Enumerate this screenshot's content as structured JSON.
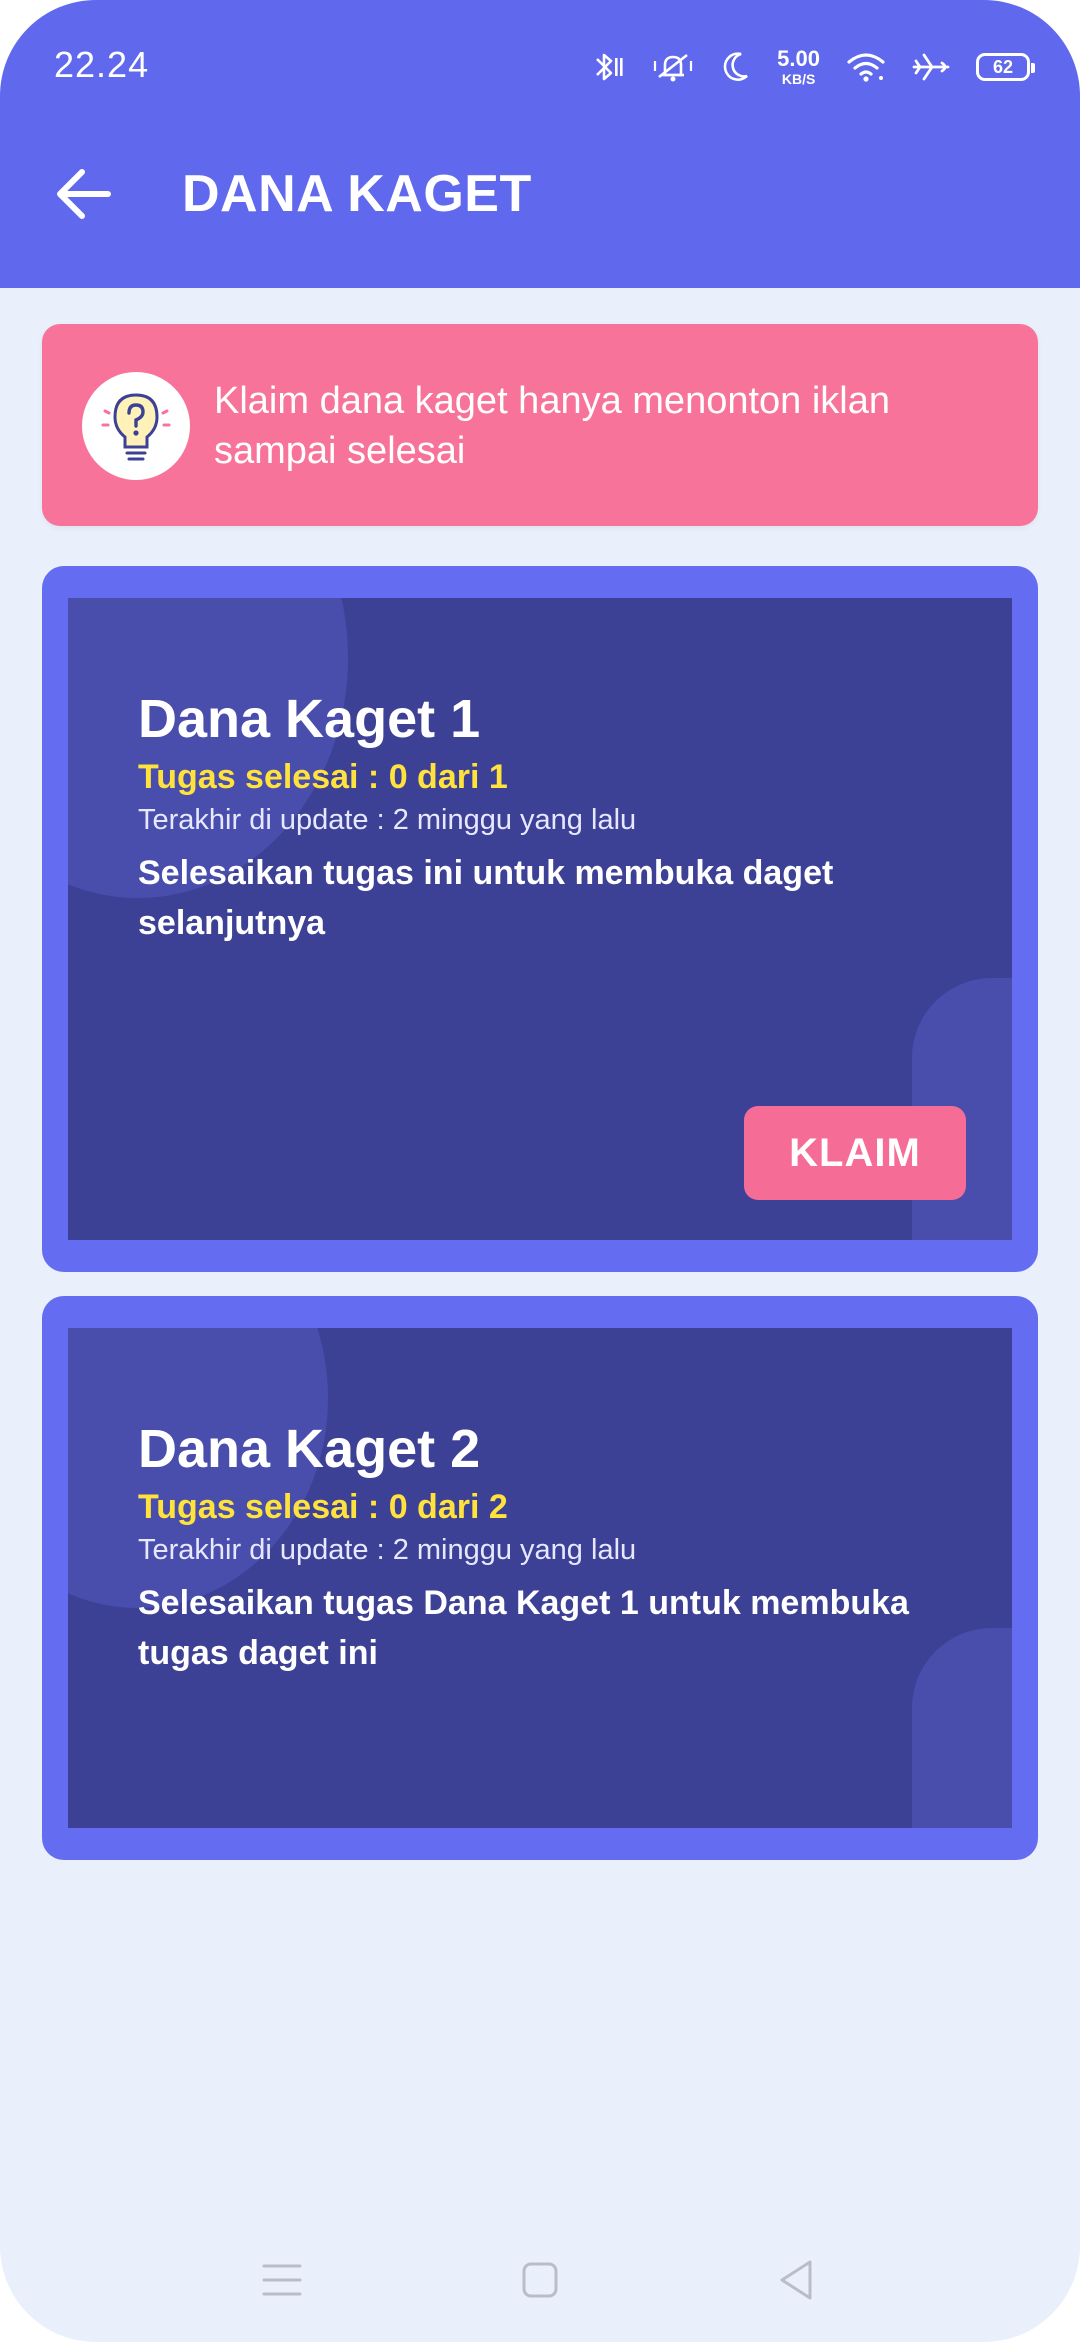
{
  "status_bar": {
    "time": "22.24",
    "net_speed": "5.00",
    "net_unit": "KB/S",
    "battery": "62",
    "icons": [
      "bluetooth-icon",
      "vibrate-icon",
      "moon-icon",
      "wifi-icon",
      "airplane-icon",
      "battery-icon"
    ]
  },
  "app_bar": {
    "title": "DANA KAGET",
    "back_icon": "arrow-left-icon"
  },
  "banner": {
    "icon": "lightbulb-question-icon",
    "text": "Klaim dana kaget hanya menonton iklan sampai selesai"
  },
  "cards": [
    {
      "title": "Dana Kaget 1",
      "progress": "Tugas selesai : 0 dari 1",
      "updated": "Terakhir di update : 2 minggu yang lalu",
      "description": "Selesaikan tugas ini untuk membuka daget selanjutnya",
      "button_label": "KLAIM"
    },
    {
      "title": "Dana Kaget 2",
      "progress": "Tugas selesai : 0 dari 2",
      "updated": "Terakhir di update : 2 minggu yang lalu",
      "description": "Selesaikan tugas Dana Kaget 1 untuk membuka tugas daget ini"
    }
  ],
  "nav_bar": {
    "icons": [
      "menu-icon",
      "home-icon",
      "back-triangle-icon"
    ]
  },
  "colors": {
    "primary": "#6068ee",
    "banner": "#f8739a",
    "card_frame": "#646cf2",
    "card_body": "#3d4196",
    "progress_text": "#ffe23b",
    "button": "#f56c96",
    "background": "#eaf0fb"
  }
}
